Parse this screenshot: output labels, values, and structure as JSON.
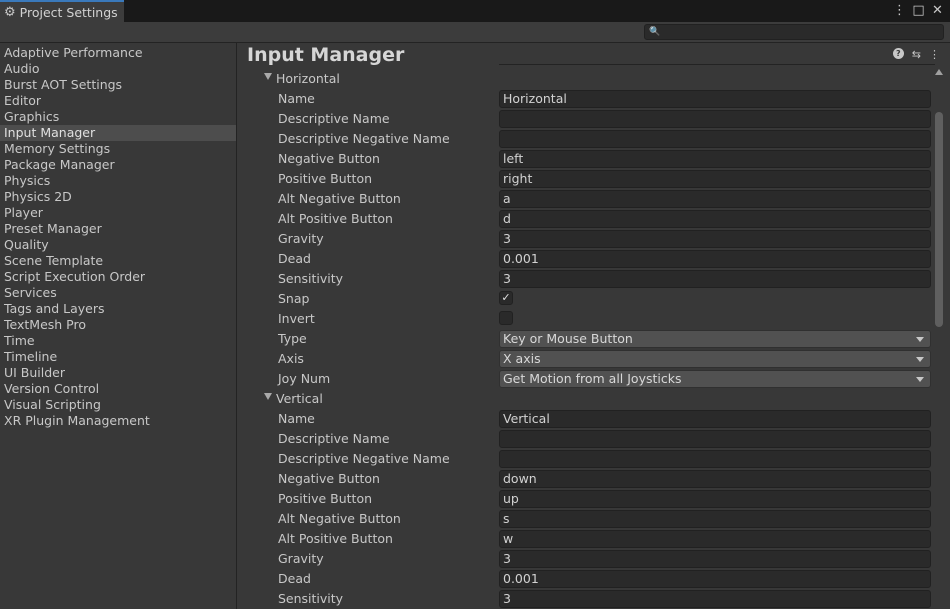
{
  "window": {
    "tab_title": "Project Settings",
    "tab_icon": "gear-icon",
    "controls": {
      "menu": "⋮",
      "maximize": "□",
      "close": "✕"
    }
  },
  "search": {
    "value": "",
    "placeholder": ""
  },
  "sidebar": {
    "items": [
      "Adaptive Performance",
      "Audio",
      "Burst AOT Settings",
      "Editor",
      "Graphics",
      "Input Manager",
      "Memory Settings",
      "Package Manager",
      "Physics",
      "Physics 2D",
      "Player",
      "Preset Manager",
      "Quality",
      "Scene Template",
      "Script Execution Order",
      "Services",
      "Tags and Layers",
      "TextMesh Pro",
      "Time",
      "Timeline",
      "UI Builder",
      "Version Control",
      "Visual Scripting",
      "XR Plugin Management"
    ],
    "selected": "Input Manager"
  },
  "main": {
    "title": "Input Manager",
    "header_icons": [
      "help-icon",
      "preset-sliders-icon",
      "kebab-menu-icon"
    ],
    "axes": [
      {
        "header": "Horizontal",
        "rows": [
          {
            "label": "Name",
            "kind": "text",
            "value": "Horizontal"
          },
          {
            "label": "Descriptive Name",
            "kind": "text",
            "value": ""
          },
          {
            "label": "Descriptive Negative Name",
            "kind": "text",
            "value": ""
          },
          {
            "label": "Negative Button",
            "kind": "text",
            "value": "left"
          },
          {
            "label": "Positive Button",
            "kind": "text",
            "value": "right"
          },
          {
            "label": "Alt Negative Button",
            "kind": "text",
            "value": "a"
          },
          {
            "label": "Alt Positive Button",
            "kind": "text",
            "value": "d"
          },
          {
            "label": "Gravity",
            "kind": "text",
            "value": "3"
          },
          {
            "label": "Dead",
            "kind": "text",
            "value": "0.001"
          },
          {
            "label": "Sensitivity",
            "kind": "text",
            "value": "3"
          },
          {
            "label": "Snap",
            "kind": "check",
            "checked": true
          },
          {
            "label": "Invert",
            "kind": "check",
            "checked": false
          },
          {
            "label": "Type",
            "kind": "dropdown",
            "value": "Key or Mouse Button"
          },
          {
            "label": "Axis",
            "kind": "dropdown",
            "value": "X axis"
          },
          {
            "label": "Joy Num",
            "kind": "dropdown",
            "value": "Get Motion from all Joysticks"
          }
        ]
      },
      {
        "header": "Vertical",
        "rows": [
          {
            "label": "Name",
            "kind": "text",
            "value": "Vertical"
          },
          {
            "label": "Descriptive Name",
            "kind": "text",
            "value": ""
          },
          {
            "label": "Descriptive Negative Name",
            "kind": "text",
            "value": ""
          },
          {
            "label": "Negative Button",
            "kind": "text",
            "value": "down"
          },
          {
            "label": "Positive Button",
            "kind": "text",
            "value": "up"
          },
          {
            "label": "Alt Negative Button",
            "kind": "text",
            "value": "s"
          },
          {
            "label": "Alt Positive Button",
            "kind": "text",
            "value": "w"
          },
          {
            "label": "Gravity",
            "kind": "text",
            "value": "3"
          },
          {
            "label": "Dead",
            "kind": "text",
            "value": "0.001"
          },
          {
            "label": "Sensitivity",
            "kind": "text",
            "value": "3"
          }
        ]
      }
    ]
  },
  "colors": {
    "tab_accent": "#3a79bb",
    "panel_bg": "#383838",
    "field_bg": "#2a2a2a",
    "dropdown_bg": "#515151",
    "selected_bg": "#4d4d4d"
  }
}
